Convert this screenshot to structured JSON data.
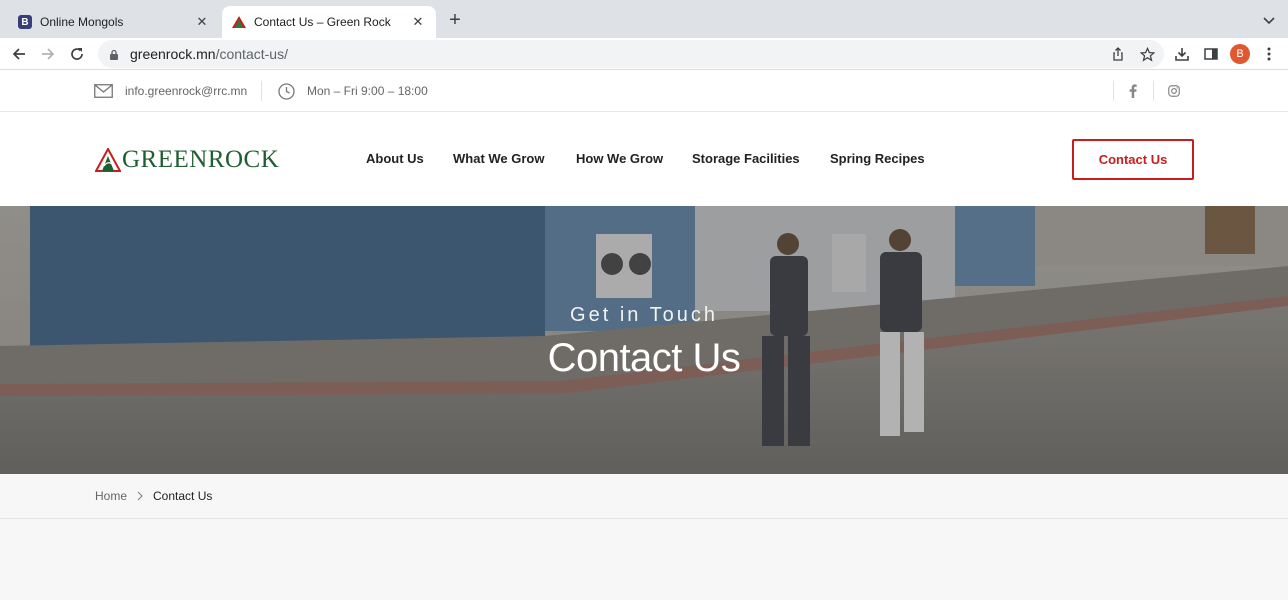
{
  "browser": {
    "tabs": [
      {
        "title": "Online Mongols",
        "favicon": "B",
        "active": false
      },
      {
        "title": "Contact Us – Green Rock",
        "favicon": "greenrock-logo",
        "active": true
      }
    ],
    "url_domain": "greenrock.mn",
    "url_path": "/contact-us/",
    "profile_initial": "B"
  },
  "topbar": {
    "email": "info.greenrock@rrc.mn",
    "hours": "Mon – Fri 9:00 – 18:00",
    "social": [
      "facebook-icon",
      "instagram-icon"
    ]
  },
  "header": {
    "logo_text": "GREENROCK",
    "nav": [
      "About Us",
      "What We Grow",
      "How We Grow",
      "Storage Facilities",
      "Spring Recipes"
    ],
    "cta_label": "Contact Us"
  },
  "hero": {
    "subtitle": "Get in Touch",
    "title": "Contact Us"
  },
  "breadcrumbs": {
    "home": "Home",
    "current": "Contact Us"
  },
  "colors": {
    "brand_green": "#1f5e31",
    "accent_red": "#c81d1d"
  }
}
